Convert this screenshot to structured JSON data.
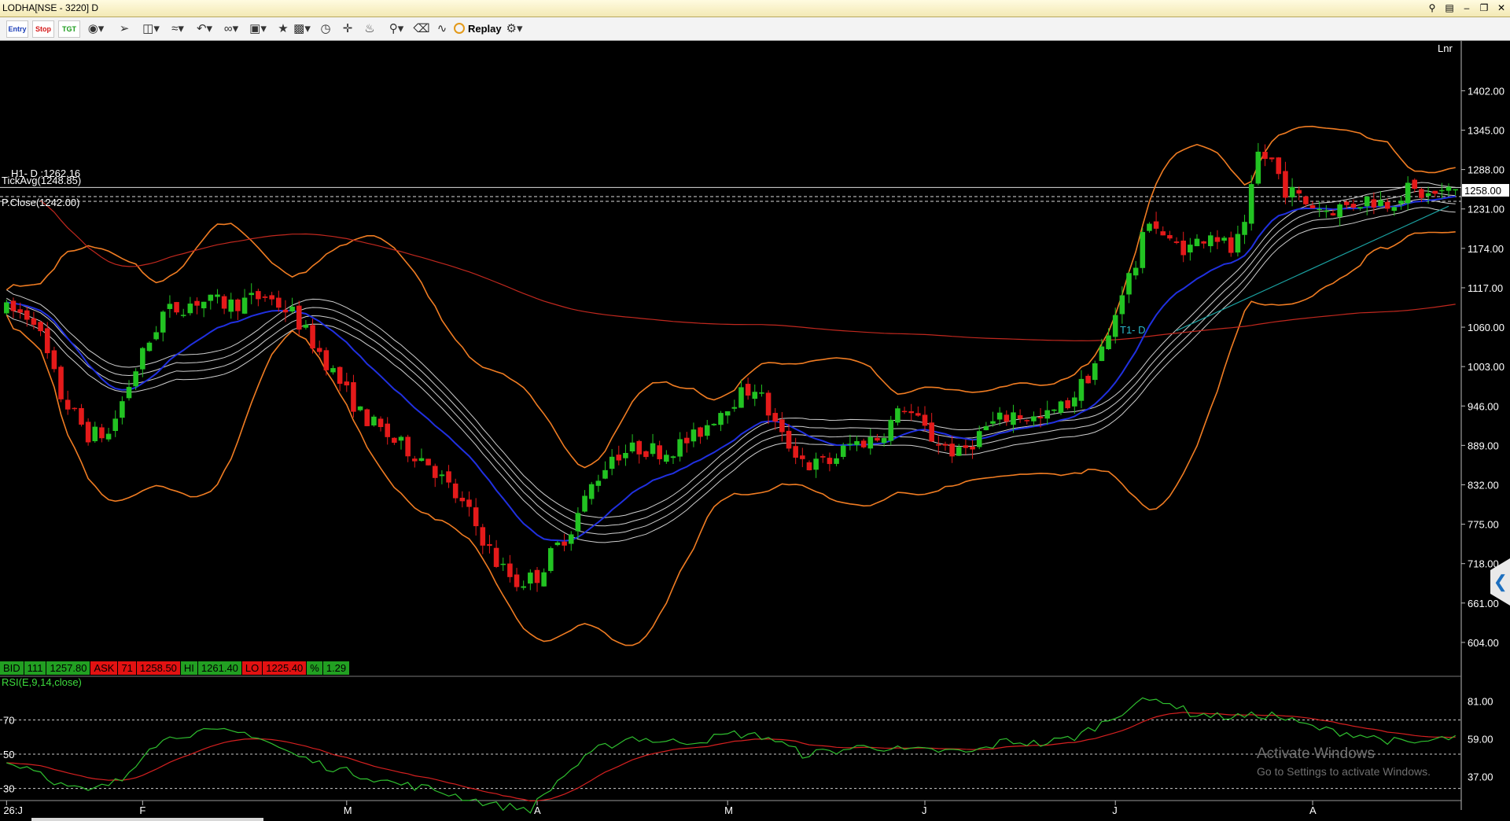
{
  "window": {
    "title": "LODHA[NSE - 3220] D",
    "buttons": [
      "minimize",
      "restore",
      "close"
    ]
  },
  "toolbar": {
    "entry_label": "Entry",
    "stop_label": "Stop",
    "tgt_label": "TGT",
    "replay_label": "Replay",
    "icons": [
      "settings-dial-icon",
      "pointer-icon",
      "bar-type-icon",
      "draw-line-icon",
      "undo-icon",
      "link-icon",
      "layout-icon",
      "star-icon",
      "indicator-icon",
      "clock-icon",
      "crosshair-icon",
      "alert-bell-icon",
      "zoom-icon",
      "delete-icon",
      "chart-icon",
      "replay-icon",
      "gear-icon"
    ]
  },
  "overlays": {
    "h1_label": "H1- D :1262.16",
    "tickavg_label": "TickAvg(1248.85)",
    "pclose_label": "P.Close(1242.00)",
    "t1_label": "T1- D",
    "scale_mode": "Lnr",
    "current_price_tag": "1258.00"
  },
  "quote_bar": {
    "bid_label": "BID",
    "bid_qty": "111",
    "bid_price": "1257.80",
    "ask_label": "ASK",
    "ask_qty": "71",
    "ask_price": "1258.50",
    "hi_label": "HI",
    "hi_value": "1261.40",
    "lo_label": "LO",
    "lo_value": "1225.40",
    "pct_label": "%",
    "pct_value": "1.29"
  },
  "rsi": {
    "label": "RSI(E,9,14,close)",
    "right_ticks": [
      "81.00",
      "59.00",
      "37.00"
    ],
    "left_ticks": [
      "70",
      "50",
      "30"
    ],
    "levels": [
      70,
      50,
      30
    ]
  },
  "watermark": {
    "line1": "Activate Windows",
    "line2": "Go to Settings to activate Windows."
  },
  "colors": {
    "up_candle": "#22c322",
    "down_candle": "#e41a1a",
    "bollinger": "#f07c22",
    "ema_blue": "#2030e0",
    "sma_red": "#c0281e",
    "envelope": "#cfcfcf",
    "rsi_line": "#2fbf2f",
    "rsi_signal": "#d42020",
    "trendline": "#1aa0a0"
  },
  "chart_data": {
    "type": "candlestick",
    "symbol": "LODHA",
    "price_axis_ticks": [
      1402,
      1345,
      1288,
      1231,
      1174,
      1117,
      1060,
      1003,
      946,
      889,
      832,
      775,
      718,
      661,
      604
    ],
    "price_axis_labels": [
      "1402.00",
      "1345.00",
      "1288.00",
      "1231.00",
      "1174.00",
      "1117.00",
      "1060.00",
      "1003.00",
      "946.00",
      "889.00",
      "832.00",
      "775.00",
      "718.00",
      "661.00",
      "604.00"
    ],
    "ylim": [
      555,
      1465
    ],
    "x_labels": [
      "26:J",
      "F",
      "M",
      "A",
      "M",
      "J",
      "J",
      "A"
    ],
    "x_label_index": [
      0,
      20,
      50,
      78,
      106,
      135,
      163,
      192
    ],
    "n_bars": 214,
    "h1_level": 1262.16,
    "tickavg_level": 1248.85,
    "pclose_level": 1242.0,
    "last_price": 1258.0,
    "price_path": [
      [
        0,
        1085
      ],
      [
        4,
        1075
      ],
      [
        8,
        960
      ],
      [
        12,
        905
      ],
      [
        15,
        905
      ],
      [
        19,
        1000
      ],
      [
        23,
        1080
      ],
      [
        28,
        1098
      ],
      [
        33,
        1093
      ],
      [
        38,
        1105
      ],
      [
        42,
        1080
      ],
      [
        47,
        1010
      ],
      [
        52,
        935
      ],
      [
        57,
        895
      ],
      [
        62,
        865
      ],
      [
        68,
        790
      ],
      [
        72,
        720
      ],
      [
        75,
        690
      ],
      [
        78,
        700
      ],
      [
        80,
        730
      ],
      [
        83,
        770
      ],
      [
        86,
        830
      ],
      [
        89,
        875
      ],
      [
        93,
        885
      ],
      [
        97,
        880
      ],
      [
        101,
        900
      ],
      [
        106,
        950
      ],
      [
        110,
        975
      ],
      [
        114,
        900
      ],
      [
        118,
        860
      ],
      [
        121,
        865
      ],
      [
        124,
        890
      ],
      [
        128,
        900
      ],
      [
        132,
        945
      ],
      [
        136,
        900
      ],
      [
        140,
        875
      ],
      [
        144,
        915
      ],
      [
        148,
        935
      ],
      [
        152,
        925
      ],
      [
        156,
        950
      ],
      [
        159,
        990
      ],
      [
        162,
        1045
      ],
      [
        164,
        1115
      ],
      [
        166,
        1150
      ],
      [
        168,
        1220
      ],
      [
        171,
        1180
      ],
      [
        174,
        1175
      ],
      [
        177,
        1200
      ],
      [
        180,
        1170
      ],
      [
        182,
        1200
      ],
      [
        184,
        1310
      ],
      [
        186,
        1300
      ],
      [
        188,
        1260
      ],
      [
        191,
        1240
      ],
      [
        194,
        1230
      ],
      [
        197,
        1235
      ],
      [
        200,
        1245
      ],
      [
        203,
        1240
      ],
      [
        206,
        1258
      ],
      [
        209,
        1250
      ],
      [
        213,
        1258
      ]
    ],
    "rsi_path": [
      [
        0,
        45
      ],
      [
        4,
        42
      ],
      [
        8,
        32
      ],
      [
        12,
        28
      ],
      [
        17,
        35
      ],
      [
        21,
        55
      ],
      [
        26,
        62
      ],
      [
        31,
        63
      ],
      [
        36,
        62
      ],
      [
        42,
        50
      ],
      [
        47,
        43
      ],
      [
        52,
        38
      ],
      [
        57,
        33
      ],
      [
        62,
        30
      ],
      [
        67,
        25
      ],
      [
        72,
        20
      ],
      [
        77,
        18
      ],
      [
        82,
        38
      ],
      [
        87,
        53
      ],
      [
        92,
        60
      ],
      [
        97,
        57
      ],
      [
        102,
        58
      ],
      [
        107,
        62
      ],
      [
        112,
        60
      ],
      [
        117,
        50
      ],
      [
        122,
        52
      ],
      [
        127,
        55
      ],
      [
        132,
        52
      ],
      [
        137,
        52
      ],
      [
        142,
        51
      ],
      [
        147,
        58
      ],
      [
        152,
        56
      ],
      [
        157,
        60
      ],
      [
        162,
        70
      ],
      [
        166,
        80
      ],
      [
        170,
        82
      ],
      [
        174,
        74
      ],
      [
        178,
        72
      ],
      [
        182,
        72
      ],
      [
        186,
        73
      ],
      [
        190,
        68
      ],
      [
        194,
        64
      ],
      [
        198,
        62
      ],
      [
        202,
        59
      ],
      [
        206,
        56
      ],
      [
        210,
        58
      ],
      [
        213,
        60
      ]
    ]
  }
}
